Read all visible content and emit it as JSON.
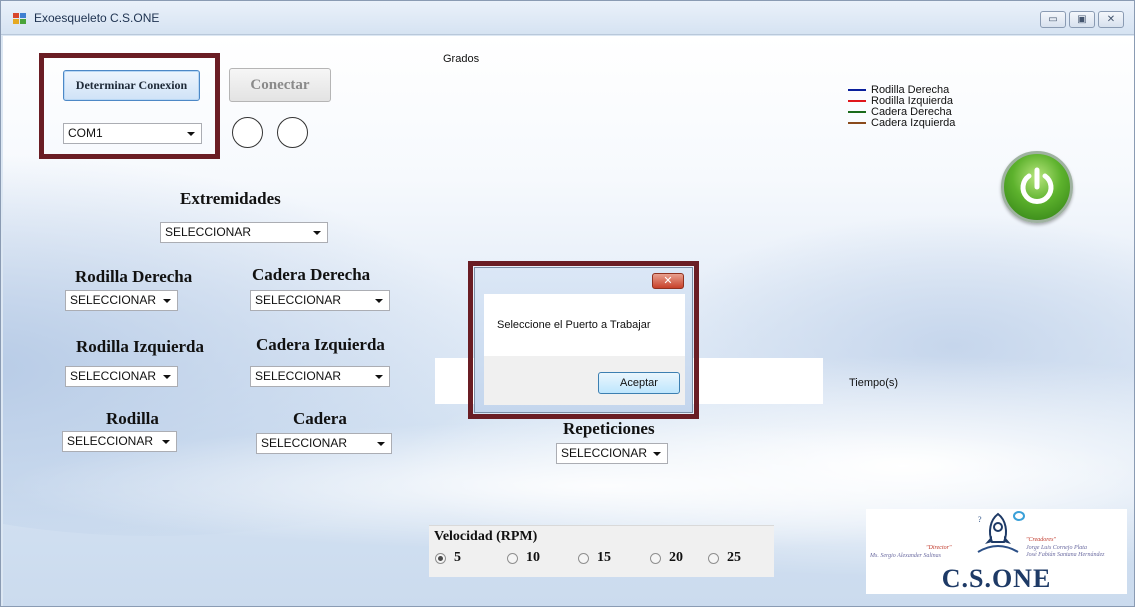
{
  "window": {
    "title": "Exoesqueleto  C.S.ONE",
    "controls": {
      "minimize": "▭",
      "maximize": "▣",
      "close": "✕"
    }
  },
  "connection": {
    "determinar_label": "Determinar Conexion",
    "port_value": "COM1",
    "conectar_label": "Conectar"
  },
  "extremidades": {
    "label": "Extremidades",
    "value": "SELECCIONAR"
  },
  "selectors": {
    "rodilla_derecha": {
      "label": "Rodilla Derecha",
      "value": "SELECCIONAR"
    },
    "cadera_derecha": {
      "label": "Cadera Derecha",
      "value": "SELECCIONAR"
    },
    "rodilla_izquierda": {
      "label": "Rodilla Izquierda",
      "value": "SELECCIONAR"
    },
    "cadera_izquierda": {
      "label": "Cadera Izquierda",
      "value": "SELECCIONAR"
    },
    "rodilla": {
      "label": "Rodilla",
      "value": "SELECCIONAR"
    },
    "cadera": {
      "label": "Cadera",
      "value": "SELECCIONAR"
    }
  },
  "repeticiones": {
    "label": "Repeticiones",
    "value": "SELECCIONAR"
  },
  "chart": {
    "ylabel": "Grados",
    "xlabel": "Tiempo(s)",
    "legend": [
      {
        "name": "Rodilla Derecha",
        "color": "#0a1f9c"
      },
      {
        "name": "Rodilla Izquierda",
        "color": "#e0161b"
      },
      {
        "name": "Cadera Derecha",
        "color": "#1b6b1b"
      },
      {
        "name": "Cadera Izquierda",
        "color": "#8a4a1c"
      }
    ]
  },
  "dialog": {
    "message": "Seleccione el Puerto a Trabajar",
    "ok_label": "Aceptar",
    "close_glyph": "✕"
  },
  "velocidad": {
    "label": "Velocidad (RPM)",
    "options": [
      "5",
      "10",
      "15",
      "20",
      "25"
    ],
    "selected": "5"
  },
  "power_icon": "power-icon",
  "logo": {
    "name": "C.S.ONE",
    "director_title": "\"Director\"",
    "director_name": "Ms. Sergio Alexander Salinas",
    "creators_title": "\"Creadores\"",
    "creator1": "Jorge Luis Cornejo Plata",
    "creator2": "José Fabián Santana Hernández"
  }
}
